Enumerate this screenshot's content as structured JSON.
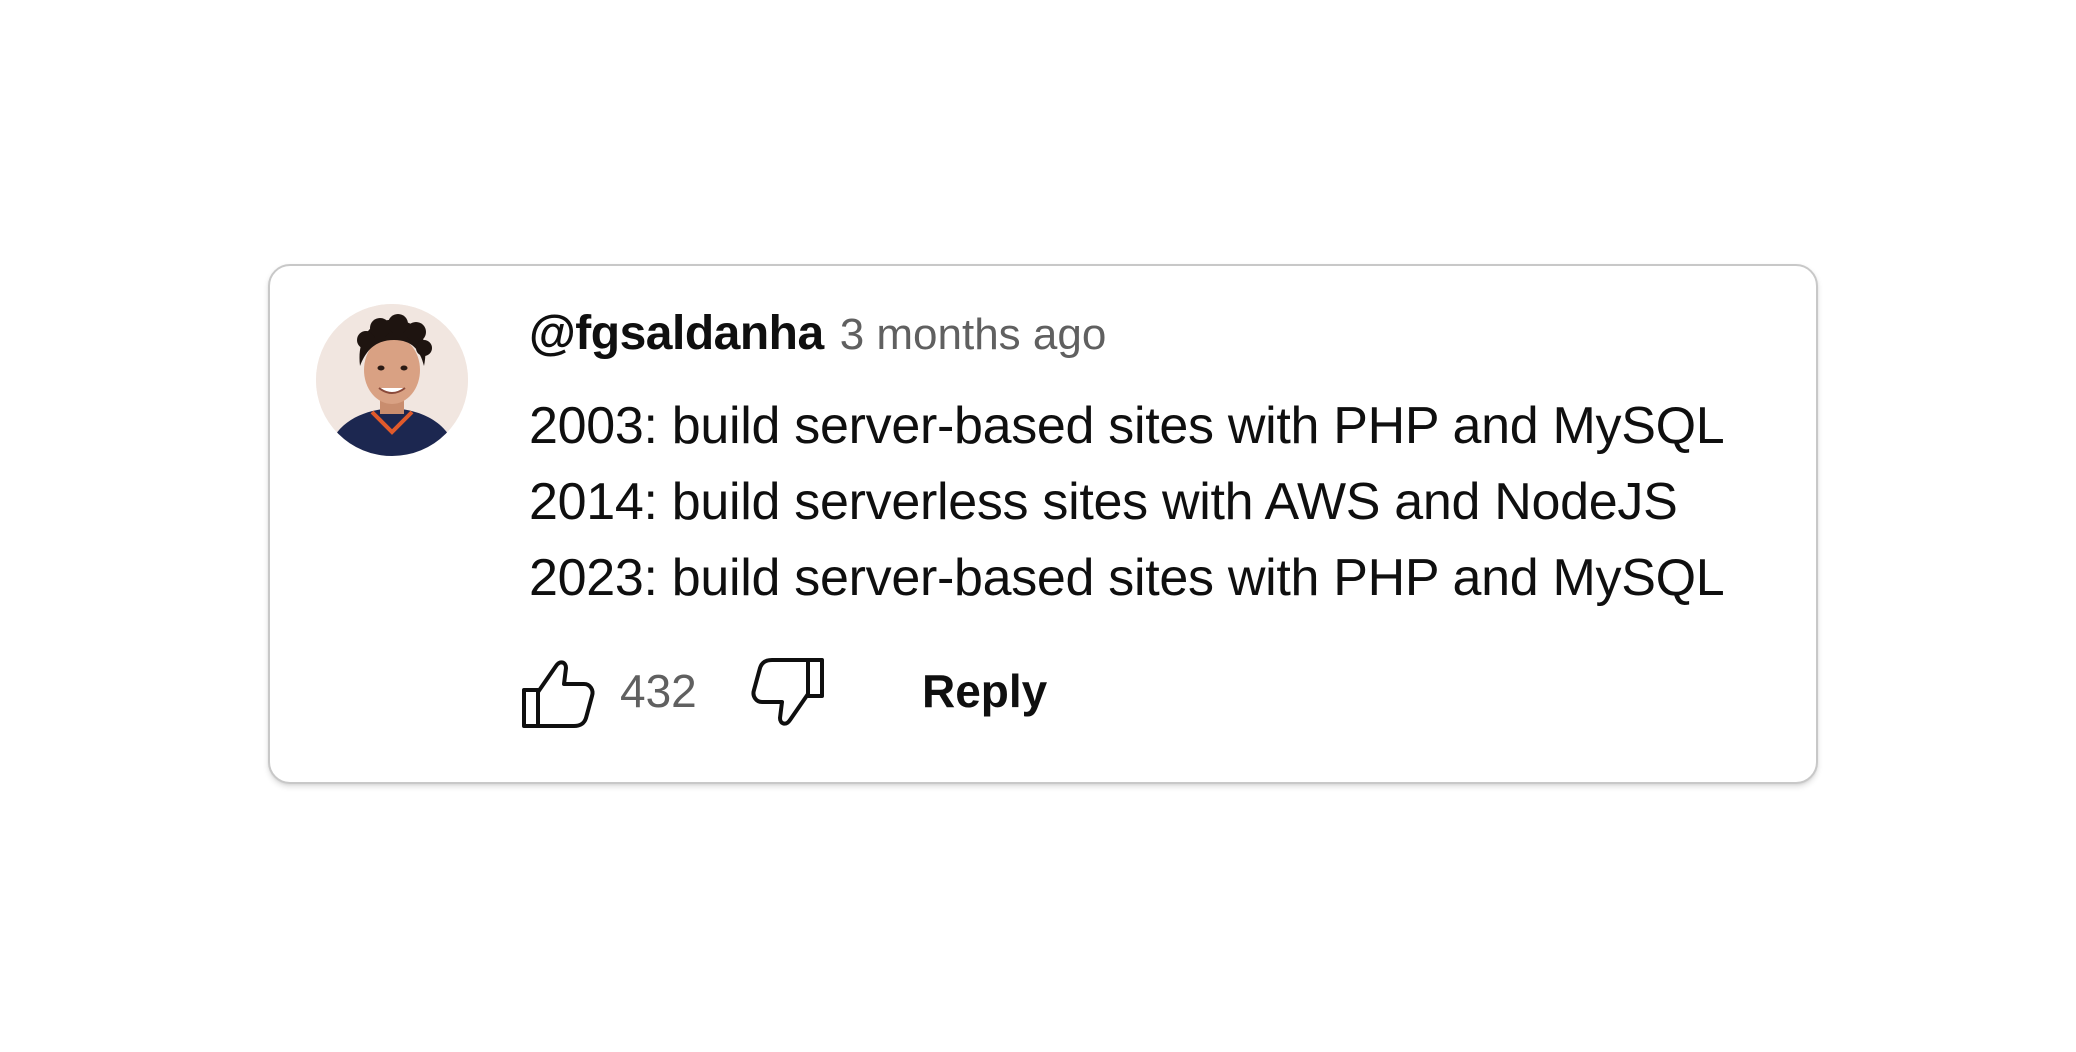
{
  "comment": {
    "author": "@fgsaldanha",
    "timestamp": "3 months ago",
    "lines": [
      "2003: build server-based sites with PHP and MySQL",
      "2014: build serverless sites with AWS and NodeJS",
      "2023: build server-based sites with PHP and MySQL"
    ],
    "likes": "432",
    "reply_label": "Reply",
    "icons": {
      "like": "thumbs-up-icon",
      "dislike": "thumbs-down-icon"
    }
  }
}
